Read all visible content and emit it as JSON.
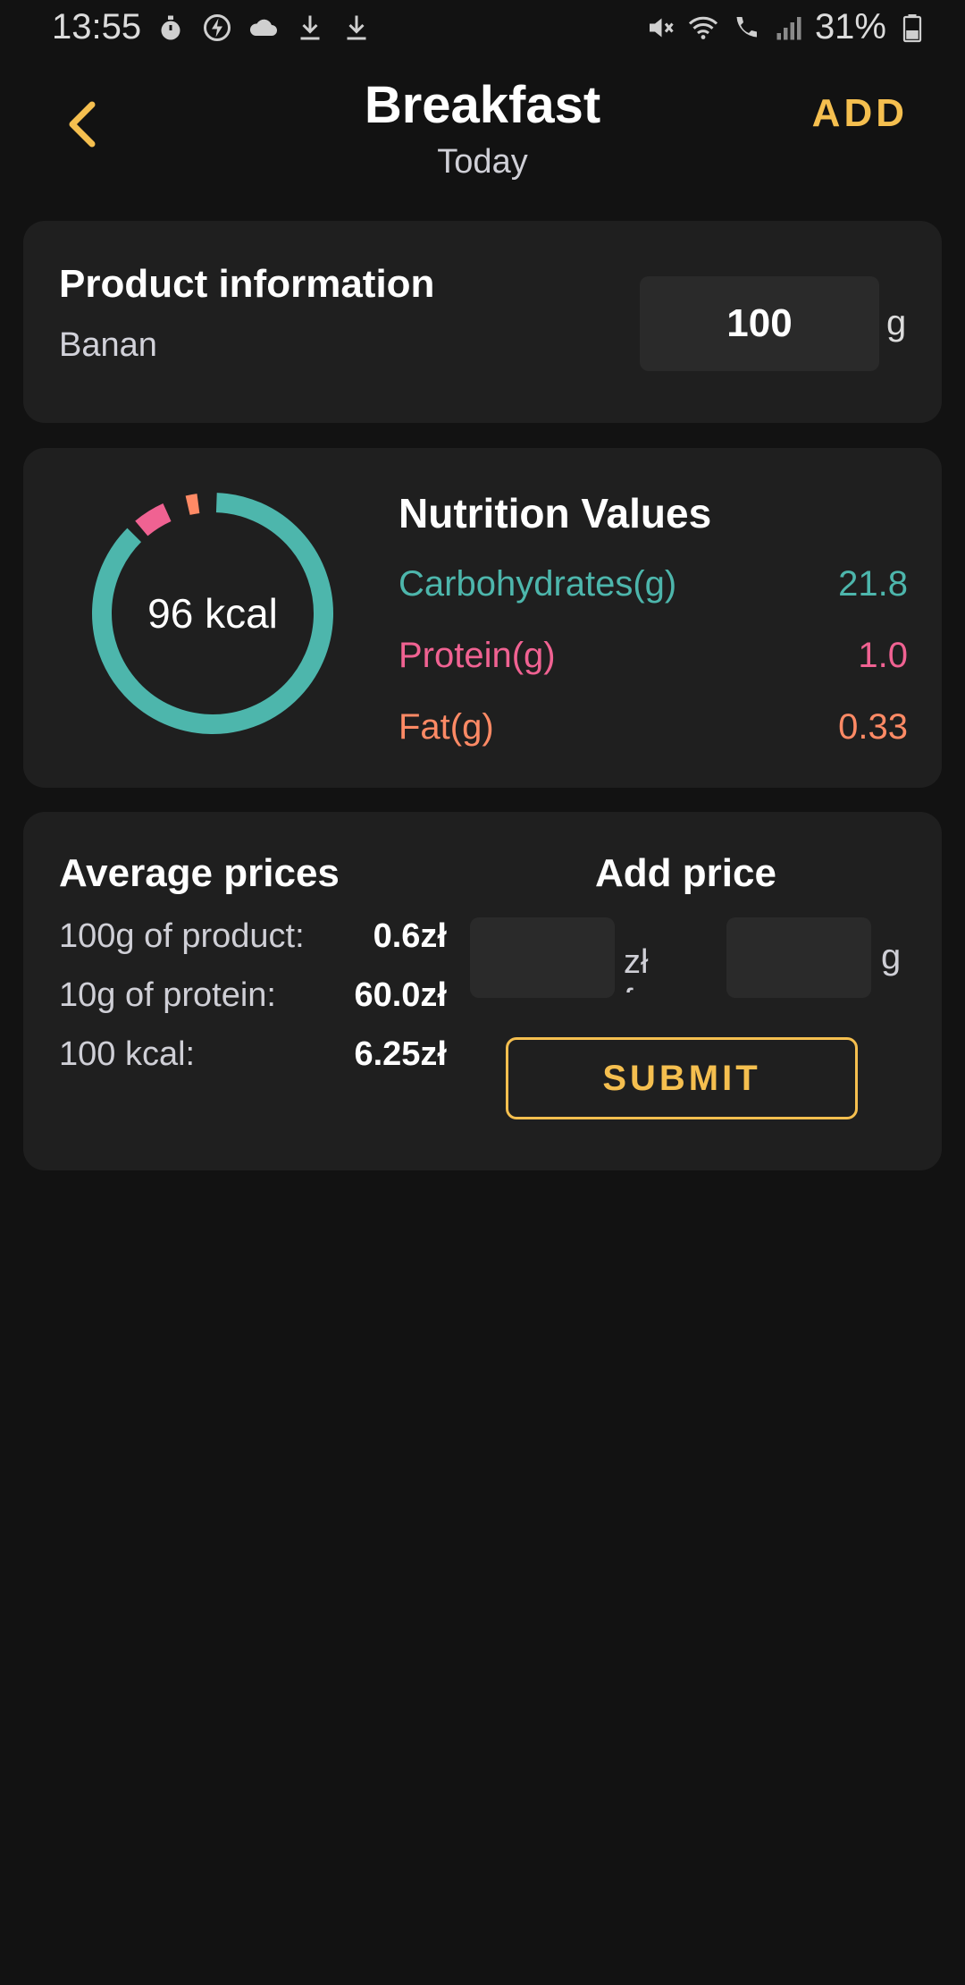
{
  "status_bar": {
    "time": "13:55",
    "battery": "31%",
    "icons_left": [
      "stopwatch-icon",
      "flash-icon",
      "cloud-icon",
      "download-icon",
      "download-icon"
    ],
    "icons_right": [
      "mute-icon",
      "wifi-icon",
      "wifi-calling-icon",
      "signal-icon",
      "battery-icon"
    ]
  },
  "header": {
    "title": "Breakfast",
    "subtitle": "Today",
    "add_label": "ADD",
    "accent_color": "#f5bf4f"
  },
  "product": {
    "title": "Product information",
    "name": "Banan",
    "grams_value": "100",
    "grams_unit": "g"
  },
  "nutrition": {
    "title": "Nutrition Values",
    "kcal_label": "96 kcal",
    "rows": [
      {
        "label": "Carbohydrates(g)",
        "value": "21.8",
        "color": "#4db6ac"
      },
      {
        "label": "Protein(g)",
        "value": "1.0",
        "color": "#f06292"
      },
      {
        "label": "Fat(g)",
        "value": "0.33",
        "color": "#ff8a65"
      }
    ]
  },
  "prices": {
    "avg_title": "Average prices",
    "rows": [
      {
        "label": "100g of product:",
        "value": "0.6zł"
      },
      {
        "label": "10g of protein:",
        "value": "60.0zł"
      },
      {
        "label": "100 kcal:",
        "value": "6.25zł"
      }
    ],
    "add_title": "Add price",
    "zl_for_label": "zł for:",
    "g_unit": "g",
    "submit_label": "SUBMIT"
  }
}
